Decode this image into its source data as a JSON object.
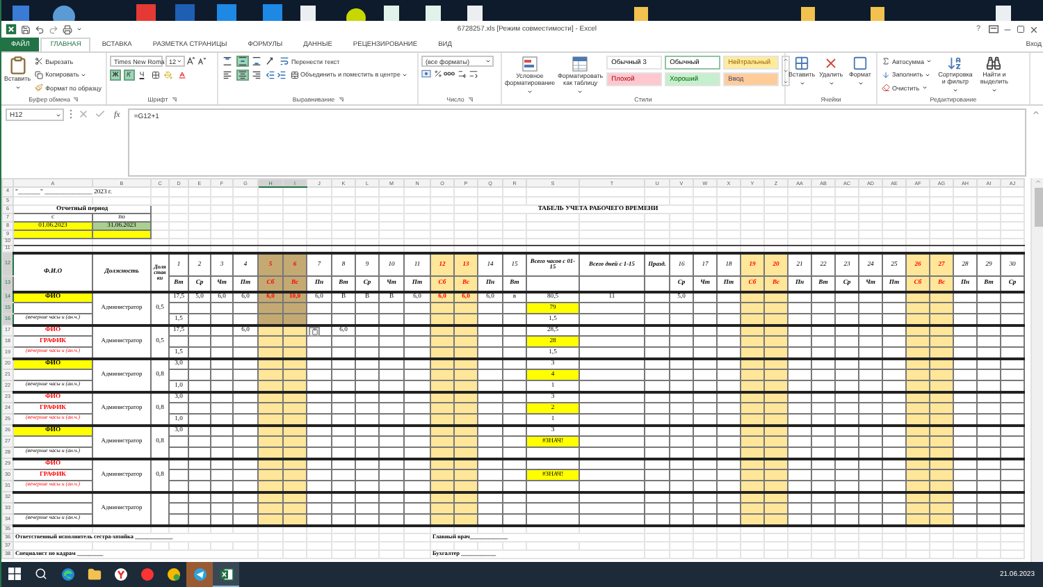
{
  "title_bar": {
    "title": "6728257.xls [Режим совместимости] - Excel",
    "help": "?"
  },
  "ribbon_tabs": [
    {
      "label": "ФАЙЛ",
      "kind": "file",
      "selected": false
    },
    {
      "label": "ГЛАВНАЯ",
      "kind": "tab",
      "selected": true
    },
    {
      "label": "ВСТАВКА",
      "kind": "tab",
      "selected": false
    },
    {
      "label": "РАЗМЕТКА СТРАНИЦЫ",
      "kind": "tab",
      "selected": false
    },
    {
      "label": "ФОРМУЛЫ",
      "kind": "tab",
      "selected": false
    },
    {
      "label": "ДАННЫЕ",
      "kind": "tab",
      "selected": false
    },
    {
      "label": "РЕЦЕНЗИРОВАНИЕ",
      "kind": "tab",
      "selected": false
    },
    {
      "label": "ВИД",
      "kind": "tab",
      "selected": false
    }
  ],
  "account": "Вход",
  "ribbon": {
    "clipboard": {
      "label": "Буфер обмена",
      "paste": "Вставить",
      "cut": "Вырезать",
      "copy": "Копировать",
      "painter": "Формат по образцу"
    },
    "font": {
      "label": "Шрифт",
      "name": "Times New Roma",
      "size": "12",
      "toggles": [
        {
          "label": "Ж",
          "kind": "bold",
          "on": true
        },
        {
          "label": "К",
          "kind": "italic",
          "on": true
        },
        {
          "label": "Ч",
          "kind": "underline",
          "on": false
        }
      ]
    },
    "alignment": {
      "label": "Выравнивание",
      "wrap": "Перенести текст",
      "merge": "Объединить и поместить в центре",
      "vertical": [
        {
          "kind": "top",
          "on": false
        },
        {
          "kind": "middle",
          "on": true
        },
        {
          "kind": "bottom",
          "on": false
        }
      ],
      "horizontal": [
        {
          "kind": "left",
          "on": false
        },
        {
          "kind": "center",
          "on": true
        },
        {
          "kind": "right",
          "on": false
        }
      ]
    },
    "number": {
      "label": "Число",
      "format": "(все форматы)"
    },
    "styles": {
      "label": "Стили",
      "conditional": "Условное форматирование",
      "as_table": "Форматировать как таблицу",
      "gallery": [
        {
          "label": "Обычный 3",
          "color": "#ffffff",
          "selected": false
        },
        {
          "label": "Обычный",
          "color": "#ffffff",
          "selected": true
        },
        {
          "label": "Нейтральный",
          "color": "#ffeb9c",
          "selected": false
        },
        {
          "label": "Плохой",
          "color": "#ffc7ce",
          "selected": false
        },
        {
          "label": "Хороший",
          "color": "#c6efce",
          "selected": false
        },
        {
          "label": "Ввод",
          "color": "#ffcc99",
          "selected": false
        }
      ]
    },
    "cells": {
      "label": "Ячейки",
      "buttons": [
        {
          "label": "Вставить",
          "kind": "insert"
        },
        {
          "label": "Удалить",
          "kind": "delete"
        },
        {
          "label": "Формат",
          "kind": "format"
        }
      ]
    },
    "editing": {
      "label": "Редактирование",
      "autosum": "Автосумма",
      "fill": "Заполнить",
      "clear": "Очистить",
      "sort": "Сортировка и фильтр",
      "find": "Найти и выделить"
    }
  },
  "formula_bar": {
    "name_box": "H12",
    "fx": "fx",
    "formula": "=G12+1"
  },
  "sheet": {
    "columns": [
      {
        "label": "A",
        "selected": false
      },
      {
        "label": "B",
        "selected": false
      },
      {
        "label": "C",
        "selected": false
      },
      {
        "label": "D",
        "selected": false
      },
      {
        "label": "E",
        "selected": false
      },
      {
        "label": "F",
        "selected": false
      },
      {
        "label": "G",
        "selected": false
      },
      {
        "label": "H",
        "selected": true
      },
      {
        "label": "I",
        "selected": true
      },
      {
        "label": "J",
        "selected": false
      },
      {
        "label": "K",
        "selected": false
      },
      {
        "label": "L",
        "selected": false
      },
      {
        "label": "M",
        "selected": false
      },
      {
        "label": "N",
        "selected": false
      },
      {
        "label": "O",
        "selected": false
      },
      {
        "label": "P",
        "selected": false
      },
      {
        "label": "Q",
        "selected": false
      },
      {
        "label": "R",
        "selected": false
      },
      {
        "label": "S",
        "selected": false
      },
      {
        "label": "T",
        "selected": false
      },
      {
        "label": "U",
        "selected": false
      },
      {
        "label": "V",
        "selected": false
      },
      {
        "label": "W",
        "selected": false
      },
      {
        "label": "X",
        "selected": false
      },
      {
        "label": "Y",
        "selected": false
      },
      {
        "label": "Z",
        "selected": false
      },
      {
        "label": "AA",
        "selected": false
      },
      {
        "label": "AB",
        "selected": false
      },
      {
        "label": "AC",
        "selected": false
      },
      {
        "label": "AD",
        "selected": false
      },
      {
        "label": "AE",
        "selected": false
      },
      {
        "label": "AF",
        "selected": false
      },
      {
        "label": "AG",
        "selected": false
      },
      {
        "label": "AH",
        "selected": false
      },
      {
        "label": "AI",
        "selected": false
      },
      {
        "label": "AJ",
        "selected": false
      }
    ],
    "rows": [
      {
        "label": "4",
        "selected": false
      },
      {
        "label": "5",
        "selected": false
      },
      {
        "label": "6",
        "selected": false
      },
      {
        "label": "7",
        "selected": false
      },
      {
        "label": "8",
        "selected": false
      },
      {
        "label": "9",
        "selected": false
      },
      {
        "label": "10",
        "selected": false
      },
      {
        "label": "11",
        "selected": false
      },
      {
        "label": "12",
        "selected": true
      },
      {
        "label": "13",
        "selected": true
      },
      {
        "label": "14",
        "selected": true
      },
      {
        "label": "15",
        "selected": true
      },
      {
        "label": "16",
        "selected": true
      },
      {
        "label": "17",
        "selected": false
      },
      {
        "label": "18",
        "selected": false
      },
      {
        "label": "19",
        "selected": false
      },
      {
        "label": "20",
        "selected": false
      },
      {
        "label": "21",
        "selected": false
      },
      {
        "label": "22",
        "selected": false
      },
      {
        "label": "23",
        "selected": false
      },
      {
        "label": "24",
        "selected": false
      },
      {
        "label": "25",
        "selected": false
      },
      {
        "label": "26",
        "selected": false
      },
      {
        "label": "27",
        "selected": false
      },
      {
        "label": "28",
        "selected": false
      },
      {
        "label": "29",
        "selected": false
      },
      {
        "label": "30",
        "selected": false
      },
      {
        "label": "31",
        "selected": false
      },
      {
        "label": "32",
        "selected": false
      },
      {
        "label": "33",
        "selected": false
      },
      {
        "label": "34",
        "selected": false
      },
      {
        "label": "35",
        "selected": false
      },
      {
        "label": "36",
        "selected": false
      },
      {
        "label": "37",
        "selected": false
      },
      {
        "label": "38",
        "selected": false
      }
    ],
    "date_line": "\"_______\" _______________ 2023 г.",
    "period": {
      "title": "Отчетный период",
      "cells": [
        {
          "label": "с",
          "value": "01.06.2023",
          "color": "#ffff00"
        },
        {
          "label": "по",
          "value": "31.06.2023",
          "color": "#a9d08e"
        }
      ]
    },
    "table_title": "ТАБЕЛЬ УЧЕТА РАБОЧЕГО ВРЕМЕНИ",
    "headers": {
      "name": "Ф.И.О",
      "position": "Должность",
      "rate": "Доля ставки",
      "total_hours": "Всего часов с 01-15",
      "total_days": "Всего дней с 1-15",
      "holiday": "Празд."
    },
    "days": [
      {
        "number": "1",
        "weekday": "Вт",
        "weekend": false
      },
      {
        "number": "2",
        "weekday": "Ср",
        "weekend": false
      },
      {
        "number": "3",
        "weekday": "Чт",
        "weekend": false
      },
      {
        "number": "4",
        "weekday": "Пт",
        "weekend": false
      },
      {
        "number": "5",
        "weekday": "Сб",
        "weekend": true
      },
      {
        "number": "6",
        "weekday": "Вс",
        "weekend": true
      },
      {
        "number": "7",
        "weekday": "Пн",
        "weekend": false
      },
      {
        "number": "8",
        "weekday": "Вт",
        "weekend": false
      },
      {
        "number": "9",
        "weekday": "Ср",
        "weekend": false
      },
      {
        "number": "10",
        "weekday": "Чт",
        "weekend": false
      },
      {
        "number": "11",
        "weekday": "Пт",
        "weekend": false
      },
      {
        "number": "12",
        "weekday": "Сб",
        "weekend": true
      },
      {
        "number": "13",
        "weekday": "Вс",
        "weekend": true
      },
      {
        "number": "14",
        "weekday": "Пн",
        "weekend": false
      },
      {
        "number": "15",
        "weekday": "Вт",
        "weekend": false
      },
      {
        "number": "16",
        "weekday": "Ср",
        "weekend": false
      },
      {
        "number": "17",
        "weekday": "Чт",
        "weekend": false
      },
      {
        "number": "18",
        "weekday": "Пт",
        "weekend": false
      },
      {
        "number": "19",
        "weekday": "Сб",
        "weekend": true
      },
      {
        "number": "20",
        "weekday": "Вс",
        "weekend": true
      },
      {
        "number": "21",
        "weekday": "Пн",
        "weekend": false
      },
      {
        "number": "22",
        "weekday": "Вт",
        "weekend": false
      },
      {
        "number": "23",
        "weekday": "Ср",
        "weekend": false
      },
      {
        "number": "24",
        "weekday": "Чт",
        "weekend": false
      },
      {
        "number": "25",
        "weekday": "Пт",
        "weekend": false
      },
      {
        "number": "26",
        "weekday": "Сб",
        "weekend": true
      },
      {
        "number": "27",
        "weekday": "Вс",
        "weekend": true
      },
      {
        "number": "28",
        "weekday": "Пн",
        "weekend": false
      },
      {
        "number": "29",
        "weekday": "Вт",
        "weekend": false
      },
      {
        "number": "30",
        "weekday": "Ср",
        "weekend": false
      }
    ],
    "employees": [
      {
        "kind": "highlighted",
        "name": "ФИО",
        "note": "(вечерние часы и (ан.ч.)",
        "position": "Администратор",
        "rate": "0,5",
        "rows": [
          {
            "cells": {
              "D": "17,5",
              "E": "5,0",
              "F": "6,0",
              "G": "6,0",
              "H": "6,0",
              "I": "10,0",
              "J": "6,0",
              "K": "В",
              "L": "В",
              "M": "В",
              "N": "6,0",
              "O": "6,0",
              "P": "6,0",
              "Q": "6,0",
              "R": "в",
              "S": "80,5",
              "T": "11",
              "V": "5,0"
            },
            "total_highlighted": false
          },
          {
            "cells": {
              "S": "79"
            },
            "total_highlighted": true
          },
          {
            "cells": {
              "D": "1,5",
              "S": "1,5"
            },
            "total_highlighted": false
          }
        ]
      },
      {
        "kind": "schedule",
        "name": "ФИО",
        "schedule_label": "ГРАФИК",
        "note": "(вечерние часы и (ан.ч.)",
        "position": "Администратор",
        "rate": "0,5",
        "rows": [
          {
            "cells": {
              "D": "17,5",
              "G": "6,0",
              "K": "6,0",
              "S": "28,5"
            },
            "total_highlighted": false
          },
          {
            "cells": {
              "S": "28"
            },
            "total_highlighted": true
          },
          {
            "cells": {
              "D": "1,5",
              "S": "1,5"
            },
            "total_highlighted": false
          }
        ]
      },
      {
        "kind": "highlighted",
        "name": "ФИО",
        "note": "(вечерние часы и (ан.ч.)",
        "position": "Администратор",
        "rate": "0,8",
        "rows": [
          {
            "cells": {
              "D": "3,0",
              "S": "3"
            },
            "total_highlighted": false
          },
          {
            "cells": {
              "S": "4"
            },
            "total_highlighted": true
          },
          {
            "cells": {
              "D": "1,0",
              "S": "1"
            },
            "total_highlighted": false
          }
        ]
      },
      {
        "kind": "schedule",
        "name": "ФИО",
        "schedule_label": "ГРАФИК",
        "note": "(вечерние часы и (ан.ч.)",
        "position": "Администратор",
        "rate": "0,8",
        "rows": [
          {
            "cells": {
              "D": "3,0",
              "S": "3"
            },
            "total_highlighted": false
          },
          {
            "cells": {
              "S": "2"
            },
            "total_highlighted": true
          },
          {
            "cells": {
              "D": "1,0",
              "S": "1"
            },
            "total_highlighted": false
          }
        ]
      },
      {
        "kind": "highlighted",
        "name": "ФИО",
        "note": "(вечерние часы и (ан.ч.)",
        "position": "Администратор",
        "rate": "0,8",
        "rows": [
          {
            "cells": {
              "D": "3,0",
              "S": "3"
            },
            "total_highlighted": false
          },
          {
            "cells": {
              "S": "#ЗНАЧ!"
            },
            "total_highlighted": true
          },
          {
            "total_highlighted": false
          }
        ]
      },
      {
        "kind": "schedule",
        "name": "ФИО",
        "schedule_label": "ГРАФИК",
        "note": "(вечерние часы и (ан.ч.)",
        "position": "Администратор",
        "rate": "0,8",
        "rows": [
          {
            "total_highlighted": false
          },
          {
            "cells": {
              "S": "#ЗНАЧ!"
            },
            "total_highlighted": true
          },
          {
            "total_highlighted": false
          }
        ]
      },
      {
        "kind": "empty",
        "note": "(вечерние часы и (ан.ч.)",
        "position": "Администратор",
        "rows": [
          {
            "total_highlighted": false
          },
          {
            "total_highlighted": false
          },
          {
            "total_highlighted": false
          }
        ]
      }
    ],
    "signatures": [
      {
        "left": "Ответственный исполнитель сестра-хозяйка _____________",
        "right": "Главный врач_____________"
      },
      {
        "left": "Специалист по кадрам _________",
        "right": "Бухгалтер ____________"
      }
    ]
  },
  "taskbar": {
    "apps": [
      {
        "kind": "start",
        "active": false,
        "flashing": false
      },
      {
        "kind": "search",
        "active": false,
        "flashing": false
      },
      {
        "kind": "edge",
        "active": false,
        "flashing": false
      },
      {
        "kind": "folder",
        "active": false,
        "flashing": false
      },
      {
        "kind": "browser",
        "active": false,
        "flashing": false
      },
      {
        "kind": "yandex",
        "active": false,
        "flashing": false
      },
      {
        "kind": "mail",
        "active": false,
        "flashing": false
      },
      {
        "kind": "telegram",
        "active": false,
        "flashing": true
      },
      {
        "kind": "excel",
        "active": true,
        "flashing": false
      }
    ],
    "date": "21.06.2023"
  }
}
